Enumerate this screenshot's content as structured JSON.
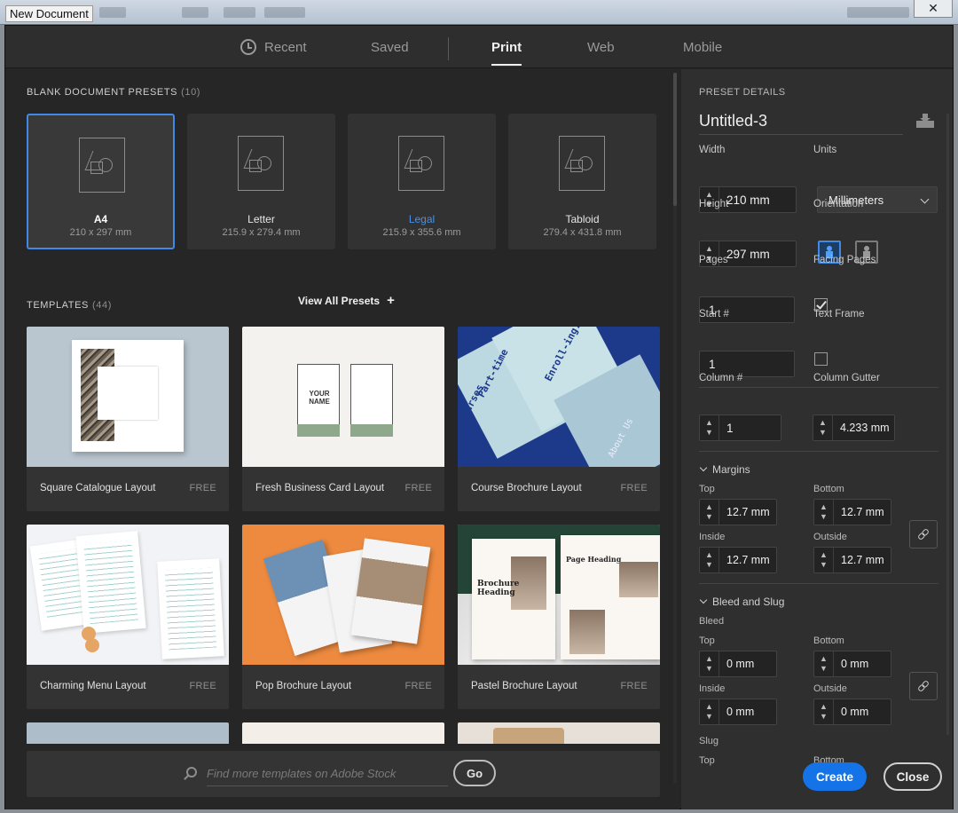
{
  "window": {
    "title": "New Document",
    "close_glyph": "✕"
  },
  "tabs": [
    {
      "label": "Recent",
      "icon": "clock-icon"
    },
    {
      "label": "Saved"
    },
    {
      "label": "Print",
      "active": true
    },
    {
      "label": "Web"
    },
    {
      "label": "Mobile"
    }
  ],
  "presets": {
    "heading": "BLANK DOCUMENT PRESETS",
    "count": "(10)",
    "items": [
      {
        "name": "A4",
        "size": "210 x 297 mm",
        "selected": true
      },
      {
        "name": "Letter",
        "size": "215.9 x 279.4 mm"
      },
      {
        "name": "Legal",
        "size": "215.9 x 355.6 mm"
      },
      {
        "name": "Tabloid",
        "size": "279.4 x 431.8 mm"
      }
    ],
    "view_all": "View All Presets",
    "view_all_icon": "plus-icon"
  },
  "templates": {
    "heading": "TEMPLATES",
    "count": "(44)",
    "items": [
      {
        "name": "Square Catalogue Layout",
        "price": "FREE"
      },
      {
        "name": "Fresh Business Card Layout",
        "price": "FREE"
      },
      {
        "name": "Course Brochure Layout",
        "price": "FREE"
      },
      {
        "name": "Charming Menu Layout",
        "price": "FREE"
      },
      {
        "name": "Pop Brochure Layout",
        "price": "FREE"
      },
      {
        "name": "Pastel Brochure Layout",
        "price": "FREE"
      }
    ],
    "thumb_text": {
      "business_card": "YOUR NAME",
      "course_1": "Enroll-ing:",
      "course_2": "Part-time",
      "course_3": "courses",
      "course_4": "About Us",
      "pastel_1": "Brochure Heading",
      "pastel_2": "Page Heading"
    }
  },
  "stock_search": {
    "placeholder": "Find more templates on Adobe Stock",
    "value": "",
    "go_label": "Go"
  },
  "details": {
    "heading": "PRESET DETAILS",
    "doc_name": "Untitled-3",
    "width_label": "Width",
    "width": "210 mm",
    "units_label": "Units",
    "units": "Millimeters",
    "height_label": "Height",
    "height": "297 mm",
    "orientation_label": "Orientation",
    "orientation": "portrait",
    "pages_label": "Pages",
    "pages": "1",
    "facing_label": "Facing Pages",
    "facing_checked": true,
    "start_label": "Start #",
    "start": "1",
    "text_frame_label": "Text Frame",
    "text_frame_checked": false,
    "column_label": "Column #",
    "columns": "1",
    "gutter_label": "Column Gutter",
    "gutter": "4.233 mm",
    "margins": {
      "heading": "Margins",
      "top_label": "Top",
      "top": "12.7 mm",
      "bottom_label": "Bottom",
      "bottom": "12.7 mm",
      "inside_label": "Inside",
      "inside": "12.7 mm",
      "outside_label": "Outside",
      "outside": "12.7 mm"
    },
    "bleed_slug": {
      "heading": "Bleed and Slug",
      "bleed_label": "Bleed",
      "top_label": "Top",
      "top": "0 mm",
      "bottom_label": "Bottom",
      "bottom": "0 mm",
      "inside_label": "Inside",
      "inside": "0 mm",
      "outside_label": "Outside",
      "outside": "0 mm",
      "slug_label": "Slug",
      "slug_top_label": "Top",
      "slug_bottom_label": "Bottom"
    },
    "create_label": "Create",
    "close_label": "Close"
  },
  "stepper": {
    "up": "▲",
    "down": "▼"
  },
  "colors": {
    "accent": "#1473e6",
    "selected_border": "#3e8ae6",
    "panel": "#2f2f2f",
    "bg": "#262626"
  }
}
